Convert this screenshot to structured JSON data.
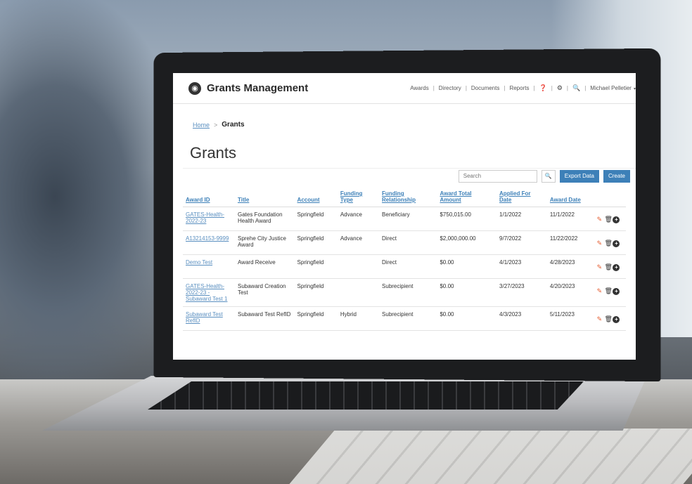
{
  "app": {
    "title": "Grants Management"
  },
  "nav": {
    "items": [
      "Awards",
      "Directory",
      "Documents",
      "Reports"
    ],
    "user": "Michael Pelletier"
  },
  "breadcrumb": {
    "home": "Home",
    "separator": ">",
    "current": "Grants"
  },
  "page": {
    "title": "Grants"
  },
  "toolbar": {
    "search_placeholder": "Search",
    "export_label": "Export Data",
    "create_label": "Create"
  },
  "table": {
    "headers": [
      "Award ID",
      "Title",
      "Account",
      "Funding Type",
      "Funding Relationship",
      "Award Total Amount",
      "Applied For Date",
      "Award Date"
    ],
    "rows": [
      {
        "award_id": "GATES-Health-2022-23",
        "title": "Gates Foundation Health Award",
        "account": "Springfield",
        "funding_type": "Advance",
        "relationship": "Beneficiary",
        "amount": "$750,015.00",
        "applied": "1/1/2022",
        "award_date": "11/1/2022"
      },
      {
        "award_id": "A13214153-9999",
        "title": "Sprehe City Justice Award",
        "account": "Springfield",
        "funding_type": "Advance",
        "relationship": "Direct",
        "amount": "$2,000,000.00",
        "applied": "9/7/2022",
        "award_date": "11/22/2022"
      },
      {
        "award_id": "Demo Test",
        "title": "Award Receive",
        "account": "Springfield",
        "funding_type": "",
        "relationship": "Direct",
        "amount": "$0.00",
        "applied": "4/1/2023",
        "award_date": "4/28/2023"
      },
      {
        "award_id": "GATES-Health-2022-23 - Subaward Test 1",
        "title": "Subaward Creation Test",
        "account": "Springfield",
        "funding_type": "",
        "relationship": "Subrecipient",
        "amount": "$0.00",
        "applied": "3/27/2023",
        "award_date": "4/20/2023"
      },
      {
        "award_id": "Subaward Test RefID",
        "title": "Subaward Test RefID",
        "account": "Springfield",
        "funding_type": "Hybrid",
        "relationship": "Subrecipient",
        "amount": "$0.00",
        "applied": "4/3/2023",
        "award_date": "5/11/2023"
      }
    ]
  },
  "icons": {
    "edit": "edit-icon",
    "delete": "trash-icon",
    "add": "plus-circle-icon",
    "help": "question-circle-icon",
    "settings": "gear-icon",
    "search": "search-icon"
  },
  "colors": {
    "accent": "#3d80b8",
    "link": "#5a8fc0",
    "edit_icon": "#e55b2f"
  }
}
